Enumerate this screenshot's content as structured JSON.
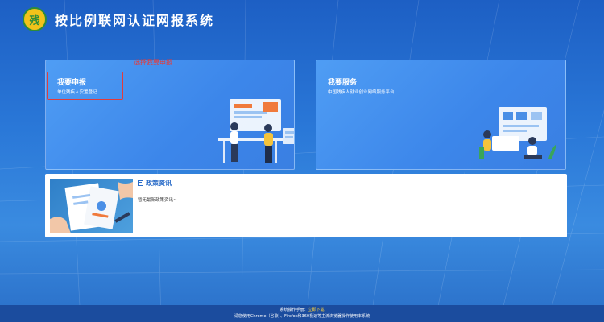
{
  "header": {
    "title": "按比例联网认证网报系统",
    "logo_text": "残"
  },
  "cards": {
    "report": {
      "title": "我要申报",
      "subtitle": "单位残疾人安置登记"
    },
    "service": {
      "title": "我要服务",
      "subtitle": "中国残疾人就业创业网络服务平台"
    }
  },
  "annotation": {
    "note": "选择我要申报"
  },
  "news": {
    "title": "政策资讯",
    "empty_text": "暂无最新政策资讯~"
  },
  "footer": {
    "manual_label": "系统操作手册：",
    "manual_link": "立即下载",
    "browser_tip": "请您使用Chrome（谷歌）、Firefox和360极速等主流浏览器操作使用本系统"
  },
  "colors": {
    "accent": "#2a6cc8",
    "annotation": "#e23b3b",
    "link": "#ffd43b"
  }
}
